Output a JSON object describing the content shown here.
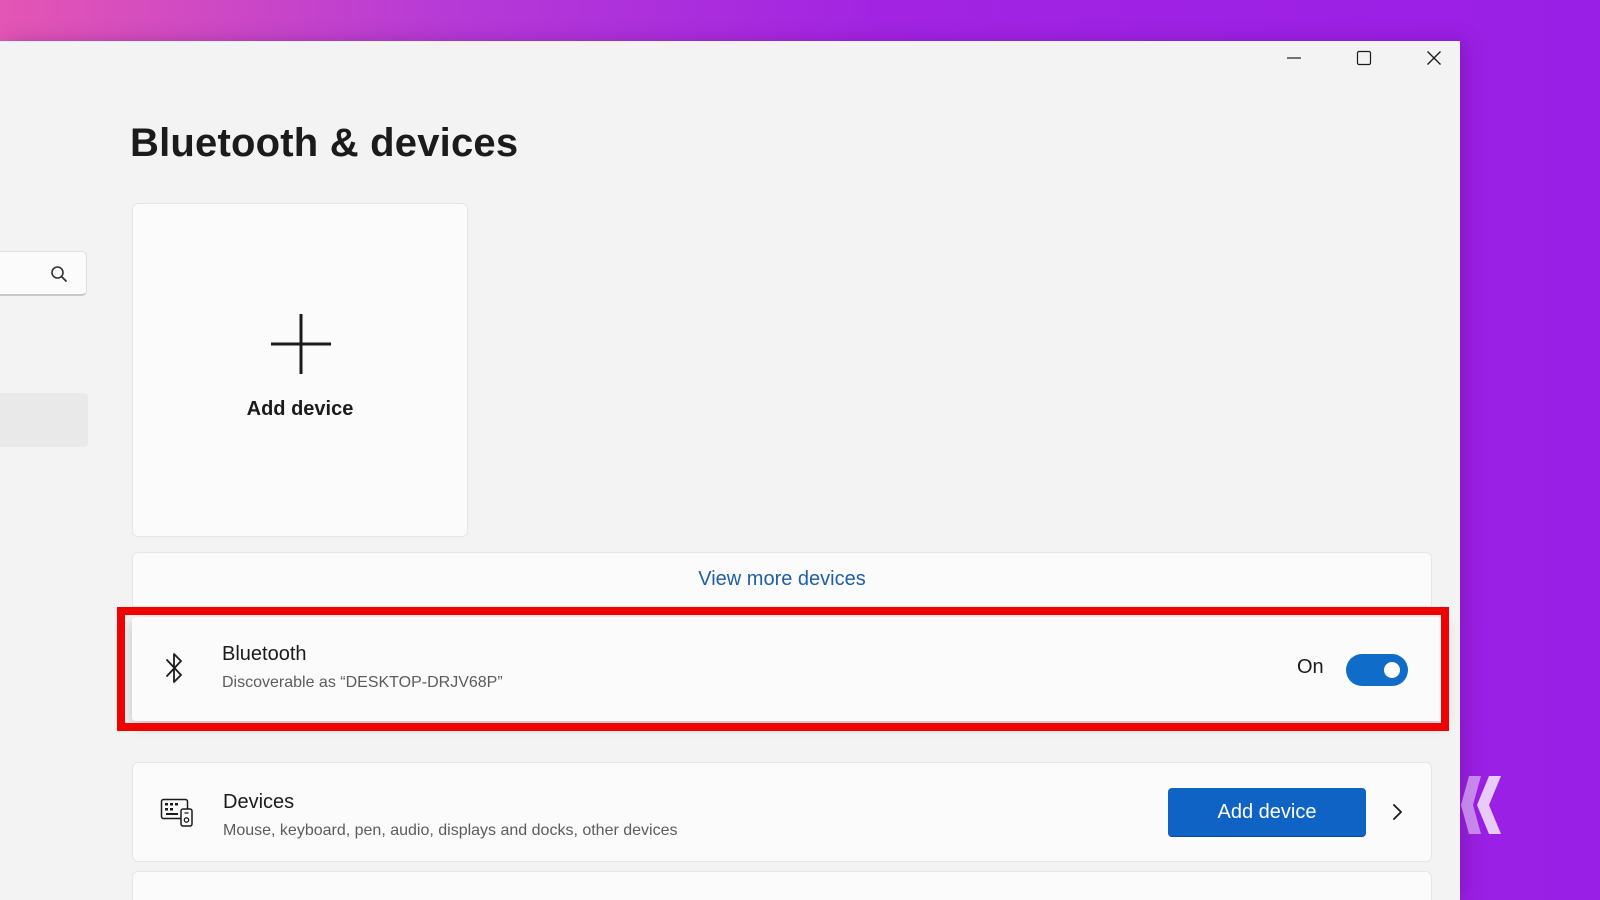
{
  "window": {
    "minimize_glyph": "minimize-icon",
    "maximize_glyph": "maximize-icon",
    "close_glyph": "close-icon"
  },
  "page": {
    "title": "Bluetooth & devices"
  },
  "add_tile": {
    "label": "Add device",
    "icon": "plus-icon"
  },
  "view_more": {
    "label": "View more devices"
  },
  "bluetooth": {
    "title": "Bluetooth",
    "subtitle": "Discoverable as “DESKTOP-DRJV68P”",
    "toggle_label": "On",
    "toggle_on": true,
    "icon": "bluetooth-icon"
  },
  "devices": {
    "title": "Devices",
    "subtitle": "Mouse, keyboard, pen, audio, displays and docks, other devices",
    "button_label": "Add device",
    "icon": "devices-icon"
  },
  "colors": {
    "accent": "#0f6cc8",
    "highlight_border": "#ee0202",
    "link": "#1d5fa8"
  }
}
